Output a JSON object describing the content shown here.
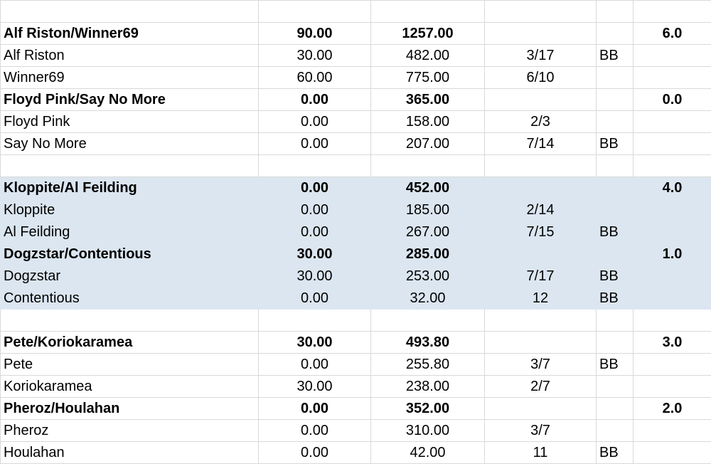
{
  "rows": [
    {
      "type": "empty"
    },
    {
      "type": "team",
      "name": "Alf Riston/Winner69",
      "a": "90.00",
      "b": "1257.00",
      "c": "",
      "d": "",
      "e": "6.0",
      "shade": false
    },
    {
      "type": "player",
      "name": "Alf Riston",
      "a": "30.00",
      "b": "482.00",
      "c": "3/17",
      "d": "BB",
      "e": "",
      "shade": false
    },
    {
      "type": "player",
      "name": "Winner69",
      "a": "60.00",
      "b": "775.00",
      "c": "6/10",
      "d": "",
      "e": "",
      "shade": false
    },
    {
      "type": "team",
      "name": "Floyd Pink/Say No More",
      "a": "0.00",
      "b": "365.00",
      "c": "",
      "d": "",
      "e": "0.0",
      "shade": false
    },
    {
      "type": "player",
      "name": "Floyd Pink",
      "a": "0.00",
      "b": "158.00",
      "c": "2/3",
      "d": "",
      "e": "",
      "shade": false
    },
    {
      "type": "player",
      "name": "Say No More",
      "a": "0.00",
      "b": "207.00",
      "c": "7/14",
      "d": "BB",
      "e": "",
      "shade": false
    },
    {
      "type": "empty"
    },
    {
      "type": "team",
      "name": "Kloppite/Al Feilding",
      "a": "0.00",
      "b": "452.00",
      "c": "",
      "d": "",
      "e": "4.0",
      "shade": true
    },
    {
      "type": "player",
      "name": "Kloppite",
      "a": "0.00",
      "b": "185.00",
      "c": "2/14",
      "d": "",
      "e": "",
      "shade": true
    },
    {
      "type": "player",
      "name": "Al Feilding",
      "a": "0.00",
      "b": "267.00",
      "c": "7/15",
      "d": "BB",
      "e": "",
      "shade": true
    },
    {
      "type": "team",
      "name": "Dogzstar/Contentious",
      "a": "30.00",
      "b": "285.00",
      "c": "",
      "d": "",
      "e": "1.0",
      "shade": true
    },
    {
      "type": "player",
      "name": "Dogzstar",
      "a": "30.00",
      "b": "253.00",
      "c": "7/17",
      "d": "BB",
      "e": "",
      "shade": true
    },
    {
      "type": "player",
      "name": "Contentious",
      "a": "0.00",
      "b": "32.00",
      "c": "12",
      "d": "BB",
      "e": "",
      "shade": true
    },
    {
      "type": "empty"
    },
    {
      "type": "team",
      "name": "Pete/Koriokaramea",
      "a": "30.00",
      "b": "493.80",
      "c": "",
      "d": "",
      "e": "3.0",
      "shade": false
    },
    {
      "type": "player",
      "name": "Pete",
      "a": "0.00",
      "b": "255.80",
      "c": "3/7",
      "d": "BB",
      "e": "",
      "shade": false
    },
    {
      "type": "player",
      "name": "Koriokaramea",
      "a": "30.00",
      "b": "238.00",
      "c": "2/7",
      "d": "",
      "e": "",
      "shade": false
    },
    {
      "type": "team",
      "name": "Pheroz/Houlahan",
      "a": "0.00",
      "b": "352.00",
      "c": "",
      "d": "",
      "e": "2.0",
      "shade": false
    },
    {
      "type": "player",
      "name": "Pheroz",
      "a": "0.00",
      "b": "310.00",
      "c": "3/7",
      "d": "",
      "e": "",
      "shade": false
    },
    {
      "type": "player",
      "name": "Houlahan",
      "a": "0.00",
      "b": "42.00",
      "c": "11",
      "d": "BB",
      "e": "",
      "shade": false
    }
  ]
}
